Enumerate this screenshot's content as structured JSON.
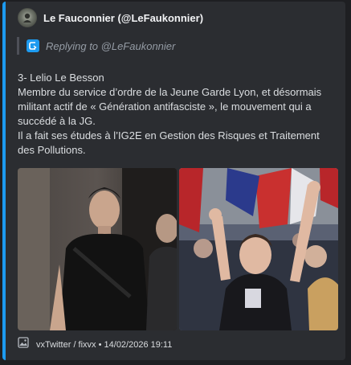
{
  "author": {
    "name": "Le Fauconnier (@LeFaukonnier)",
    "avatar_icon": "avatar-icon"
  },
  "reply": {
    "text": "Replying to @LeFaukonnier",
    "icon": "reply-icon"
  },
  "description": {
    "line1": "3- Lelio Le Besson",
    "line2": "Membre du service d’ordre de la Jeune Garde Lyon, et désormais militant actif de « Génération antifasciste », le mouvement qui a succédé à la JG.",
    "line3": "Il a fait ses études à l’IG2E en Gestion des Risques et Traitement des Pollutions."
  },
  "media": {
    "left_photo": "photo-of-young-man-in-black-tshirt",
    "right_photo": "photo-of-protest-crowd-with-flags"
  },
  "footer": {
    "text": "vxTwitter / fixvx • 14/02/2026 19:11",
    "icon": "image-icon"
  },
  "colors": {
    "accent": "#1d9bf0",
    "embed_bg": "#2b2d31",
    "page_bg": "#1e1f22",
    "text": "#dbdee1",
    "muted": "#949ba4"
  }
}
